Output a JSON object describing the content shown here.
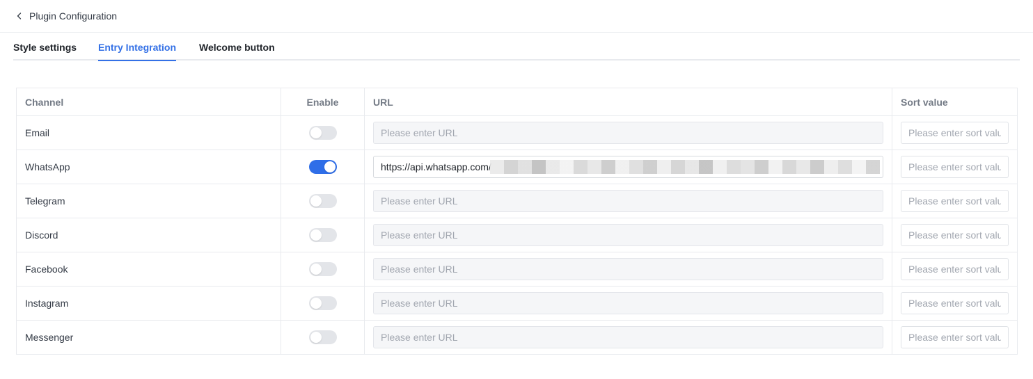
{
  "header": {
    "title": "Plugin Configuration",
    "back_icon": "chevron-left-icon"
  },
  "tabs": [
    {
      "label": "Style settings",
      "active": false
    },
    {
      "label": "Entry Integration",
      "active": true
    },
    {
      "label": "Welcome button",
      "active": false
    }
  ],
  "table": {
    "columns": {
      "channel": "Channel",
      "enable": "Enable",
      "url": "URL",
      "sort": "Sort value"
    },
    "url_placeholder": "Please enter URL",
    "sort_placeholder": "Please enter sort value",
    "rows": [
      {
        "channel": "Email",
        "enabled": false,
        "url": ""
      },
      {
        "channel": "WhatsApp",
        "enabled": true,
        "url": "https://api.whatsapp.com/"
      },
      {
        "channel": "Telegram",
        "enabled": false,
        "url": ""
      },
      {
        "channel": "Discord",
        "enabled": false,
        "url": ""
      },
      {
        "channel": "Facebook",
        "enabled": false,
        "url": ""
      },
      {
        "channel": "Instagram",
        "enabled": false,
        "url": ""
      },
      {
        "channel": "Messenger",
        "enabled": false,
        "url": ""
      }
    ]
  },
  "colors": {
    "accent": "#3370e6",
    "toggle_on": "#2f6ee8",
    "toggle_off": "#e3e5e9"
  }
}
